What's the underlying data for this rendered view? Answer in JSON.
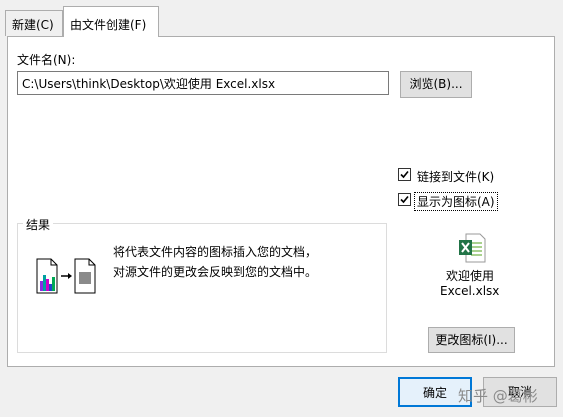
{
  "tabs": [
    {
      "label": "新建(C)"
    },
    {
      "label": "由文件创建(F)"
    }
  ],
  "filename": {
    "label": "文件名(N):",
    "value": "C:\\Users\\think\\Desktop\\欢迎使用 Excel.xlsx"
  },
  "browse_button": "浏览(B)...",
  "options": [
    {
      "label": "链接到文件(K)",
      "checked": true
    },
    {
      "label": "显示为图标(A)",
      "checked": true
    }
  ],
  "result": {
    "legend": "结果",
    "description": "将代表文件内容的图标插入您的文档，对源文件的更改会反映到您的文档中。"
  },
  "icon_preview": {
    "icon": "excel-file-icon",
    "caption_line1": "欢迎使用",
    "caption_line2": "Excel.xlsx"
  },
  "change_icon_button": "更改图标(I)...",
  "ok_button": "确定",
  "cancel_button": "取消",
  "watermark": "知乎 @葛彬",
  "colors": {
    "excel_green": "#217346",
    "focus_blue": "#0078d7"
  }
}
